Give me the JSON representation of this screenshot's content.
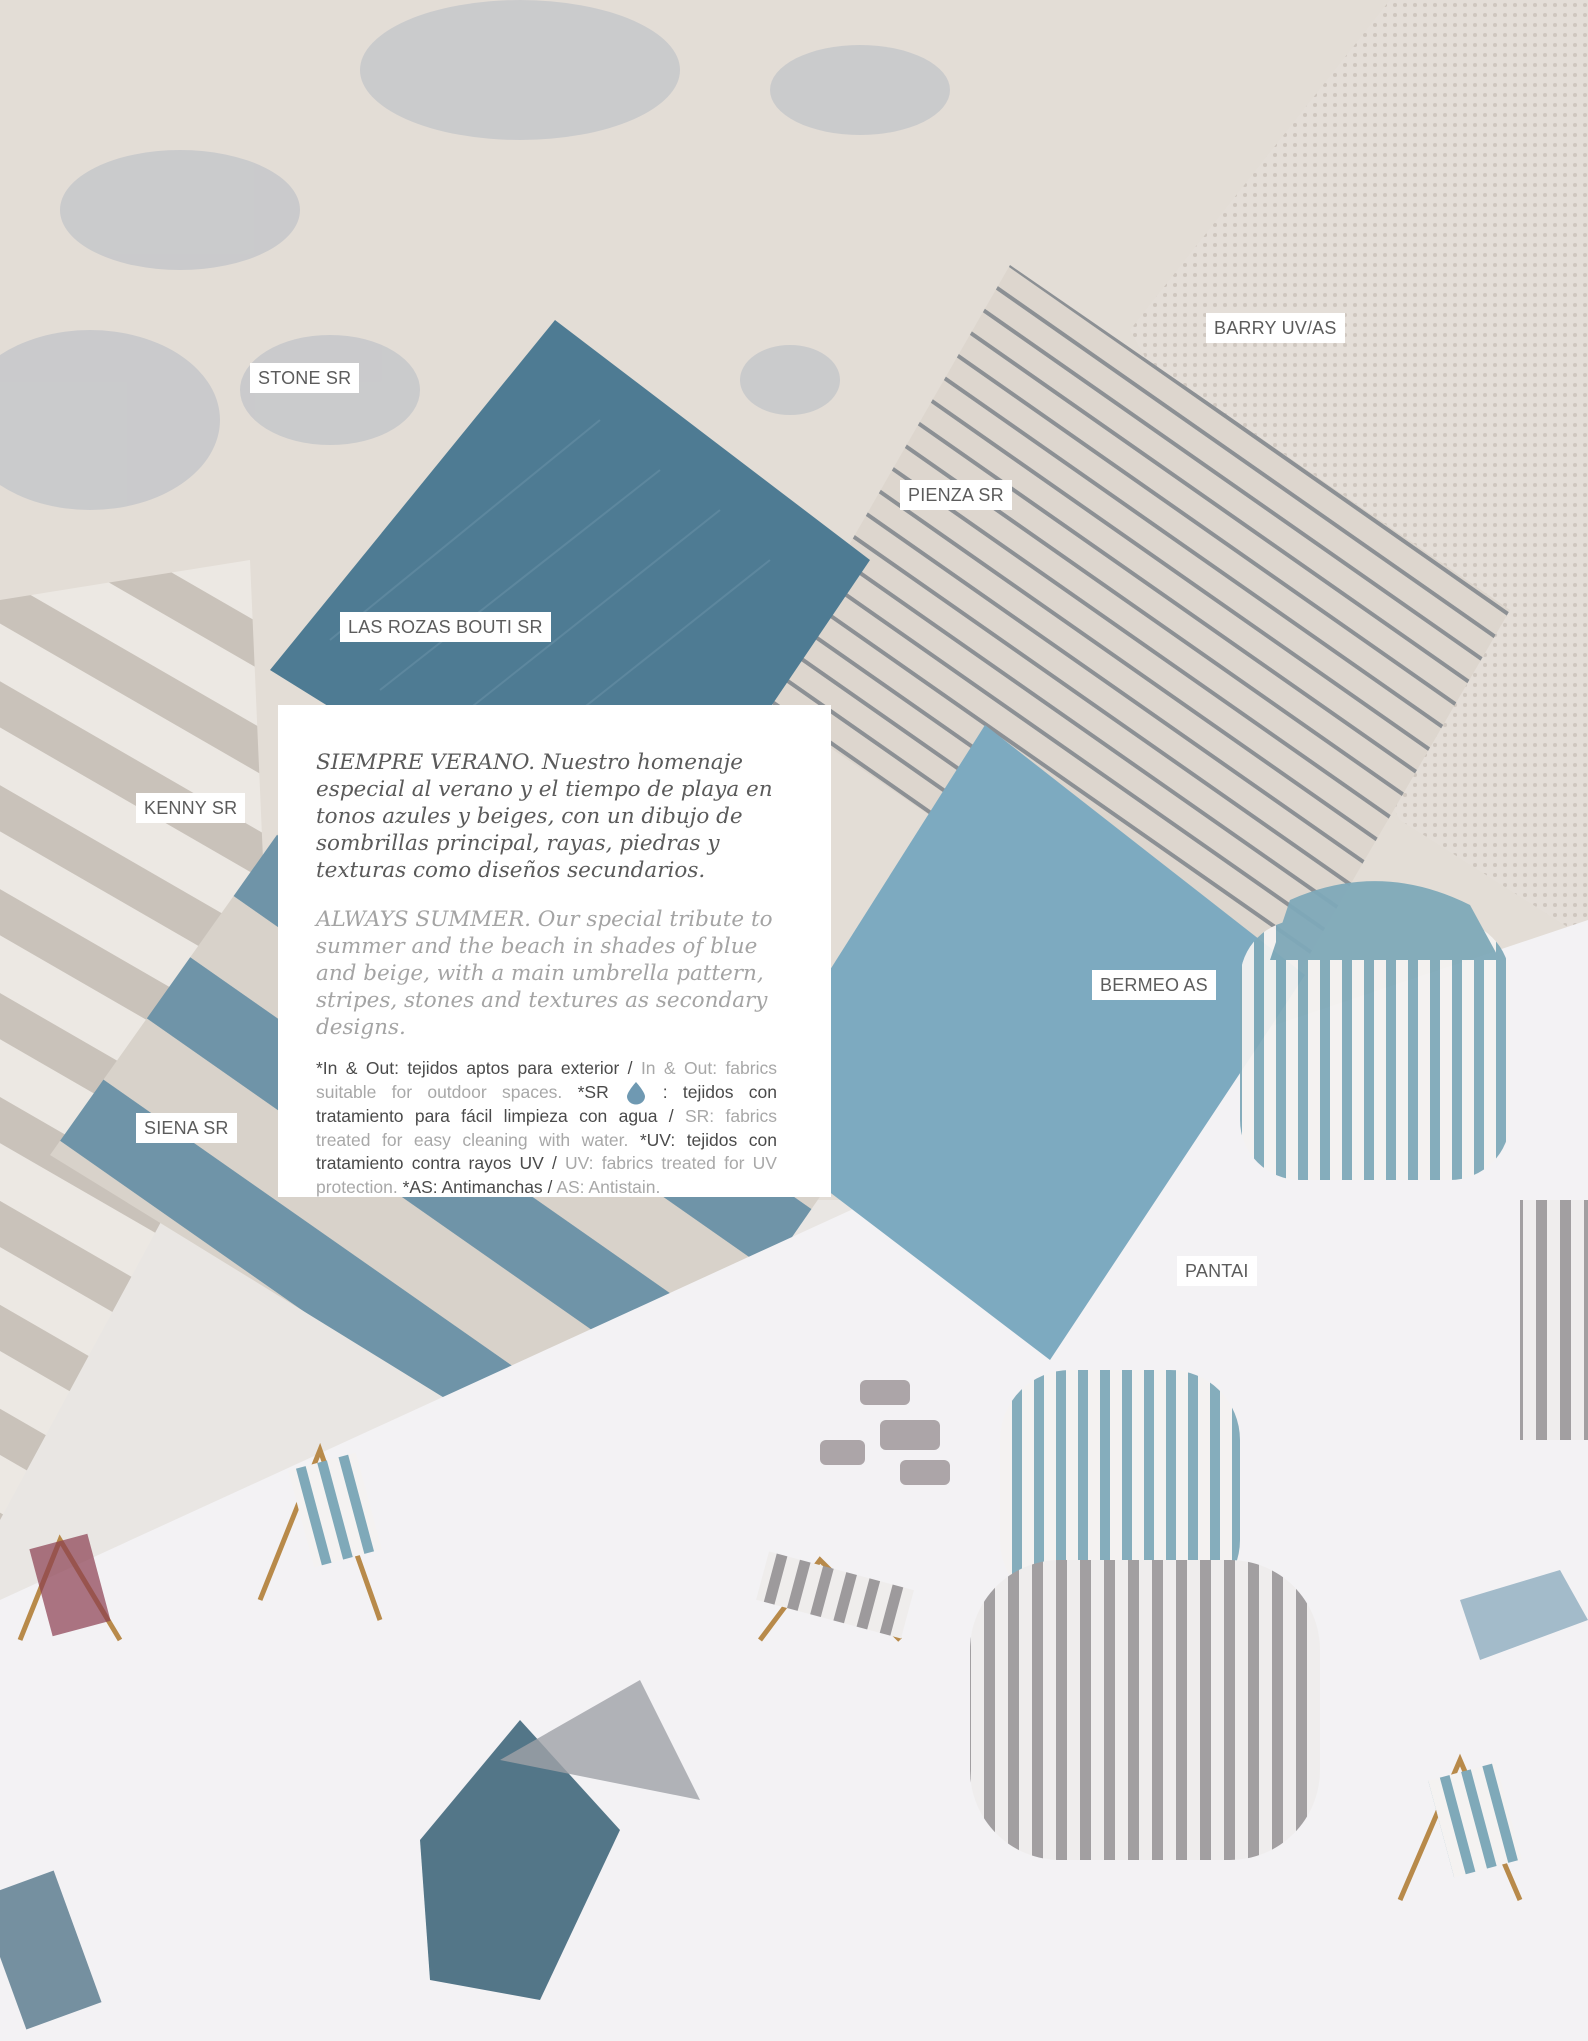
{
  "fabric_labels": {
    "stone": "STONE SR",
    "barry": "BARRY UV/AS",
    "pienza": "PIENZA SR",
    "las_rozas": "LAS ROZAS BOUTI SR",
    "kenny": "KENNY SR",
    "bermeo": "BERMEO AS",
    "siena": "SIENA SR",
    "pantai": "PANTAI"
  },
  "intro": {
    "spanish": "SIEMPRE VERANO. Nuestro homenaje especial al verano y el tiempo de playa en tonos azules y beiges, con un dibujo de sombrillas principal, rayas, piedras y texturas como diseños secundarios.",
    "english": "ALWAYS SUMMER. Our special tribute to summer and the beach in shades of blue and beige, with a main umbrella pattern, stripes, stones and textures as secondary designs."
  },
  "notes": {
    "inout_es": "*In & Out: tejidos aptos para exterior /",
    "inout_en": "In & Out: fabrics suitable for outdoor spaces.",
    "sr_es_label": "*SR",
    "sr_es": ": tejidos con tratamiento para fácil limpieza con agua /",
    "sr_en": "SR: fabrics treated for easy cleaning with water.",
    "uv_es": "*UV: tejidos con tratamiento contra rayos UV /",
    "uv_en": "UV: fabrics treated for UV protection.",
    "as_es": "*AS: Antimanchas /",
    "as_en": "AS: Antistain."
  },
  "icons": {
    "sr_icon": "water-drop-icon"
  },
  "colors": {
    "text_dark": "#5a5a5a",
    "text_light": "#a4a4a4",
    "fabric_blue_dark": "#4f7c93",
    "fabric_blue_light": "#7eaac0",
    "fabric_beige": "#d9d2c9"
  }
}
